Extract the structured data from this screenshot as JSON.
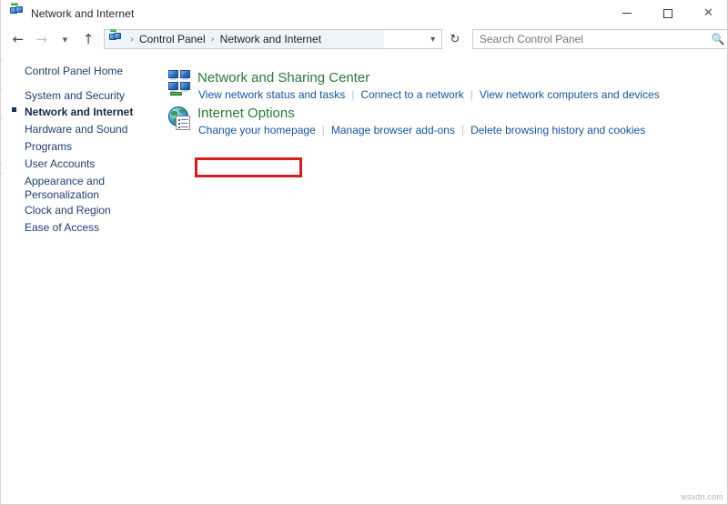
{
  "window": {
    "title": "Network and Internet",
    "title_icon": "network-icon",
    "controls": {
      "minimize": "minimize-icon",
      "maximize": "maximize-icon",
      "close": "close-icon"
    }
  },
  "navbar": {
    "back": "back-arrow-icon",
    "forward": "forward-arrow-icon",
    "recent": "chevron-down-icon",
    "up": "up-arrow-icon",
    "refresh": "refresh-icon",
    "address_chevron": "chevron-down-icon",
    "breadcrumb": {
      "icon": "network-icon",
      "items": [
        "Control Panel",
        "Network and Internet"
      ],
      "separator": "›"
    }
  },
  "search": {
    "placeholder": "Search Control Panel",
    "value": "",
    "icon": "search-icon"
  },
  "sidebar": {
    "items": [
      {
        "label": "Control Panel Home",
        "selected": false
      },
      {
        "label": "System and Security",
        "selected": false
      },
      {
        "label": "Network and Internet",
        "selected": true
      },
      {
        "label": "Hardware and Sound",
        "selected": false
      },
      {
        "label": "Programs",
        "selected": false
      },
      {
        "label": "User Accounts",
        "selected": false
      },
      {
        "label": "Appearance and Personalization",
        "selected": false
      },
      {
        "label": "Clock and Region",
        "selected": false
      },
      {
        "label": "Ease of Access",
        "selected": false
      }
    ]
  },
  "main": {
    "categories": [
      {
        "icon": "network-sharing-center-icon",
        "title": "Network and Sharing Center",
        "links": [
          "View network status and tasks",
          "Connect to a network",
          "View network computers and devices"
        ]
      },
      {
        "icon": "internet-options-icon",
        "title": "Internet Options",
        "links": [
          "Change your homepage",
          "Manage browser add-ons",
          "Delete browsing history and cookies"
        ]
      }
    ],
    "link_separator": "|"
  },
  "annotation": {
    "highlight_target": "Internet Options",
    "highlight_color": "#d31f1f"
  },
  "watermark": {
    "text": "wsxdn.com"
  },
  "colors": {
    "category_title": "#2a7935",
    "link": "#15539e",
    "sidebar_link": "#1c3f72",
    "highlight_red": "#d31f1f",
    "breadcrumb_highlight": "#eef4fb"
  }
}
